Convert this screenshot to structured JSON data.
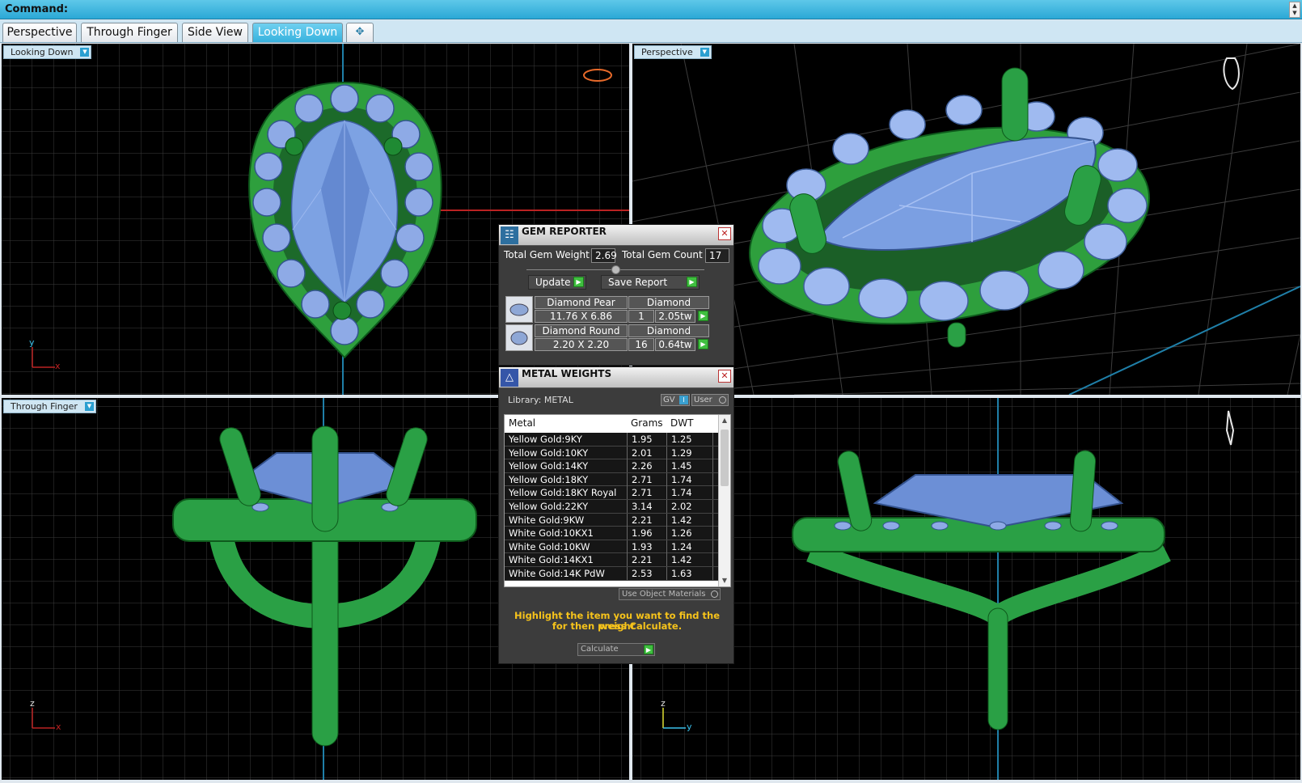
{
  "command": {
    "label": "Command:"
  },
  "tabs": [
    {
      "label": "Perspective",
      "active": false
    },
    {
      "label": "Through Finger",
      "active": false
    },
    {
      "label": "Side View",
      "active": false
    },
    {
      "label": "Looking Down",
      "active": true
    }
  ],
  "viewports": {
    "top_left": {
      "label": "Looking Down"
    },
    "top_right": {
      "label": "Perspective"
    },
    "bottom_left": {
      "label": "Through Finger"
    },
    "bottom_right": {
      "label": ""
    }
  },
  "axes": {
    "top_left": {
      "v": "y",
      "h": "x"
    },
    "bottom_left": {
      "v": "z",
      "h": "x"
    },
    "bottom_right": {
      "v": "z",
      "h": "y"
    }
  },
  "gem_reporter": {
    "title": "GEM REPORTER",
    "total_weight_label": "Total Gem Weight",
    "total_weight": "2.69",
    "total_count_label": "Total Gem Count",
    "total_count": "17",
    "update_label": "Update",
    "save_label": "Save Report",
    "gems": [
      {
        "name": "Diamond Pear",
        "material": "Diamond",
        "size": "11.76 X 6.86",
        "count": "1",
        "weight": "2.05tw"
      },
      {
        "name": "Diamond Round",
        "material": "Diamond",
        "size": "2.20 X 2.20",
        "count": "16",
        "weight": "0.64tw"
      }
    ]
  },
  "metal_weights": {
    "title": "METAL WEIGHTS",
    "library_label": "Library: METAL",
    "gv_label": "GV",
    "user_label": "User",
    "columns": [
      "Metal",
      "Grams",
      "DWT"
    ],
    "rows": [
      [
        "Yellow Gold:9KY",
        "1.95",
        "1.25"
      ],
      [
        "Yellow Gold:10KY",
        "2.01",
        "1.29"
      ],
      [
        "Yellow Gold:14KY",
        "2.26",
        "1.45"
      ],
      [
        "Yellow Gold:18KY",
        "2.71",
        "1.74"
      ],
      [
        "Yellow Gold:18KY Royal",
        "2.71",
        "1.74"
      ],
      [
        "Yellow Gold:22KY",
        "3.14",
        "2.02"
      ],
      [
        "White Gold:9KW",
        "2.21",
        "1.42"
      ],
      [
        "White Gold:10KX1",
        "1.96",
        "1.26"
      ],
      [
        "White Gold:10KW",
        "1.93",
        "1.24"
      ],
      [
        "White Gold:14KX1",
        "2.21",
        "1.42"
      ],
      [
        "White Gold:14K PdW",
        "2.53",
        "1.63"
      ]
    ],
    "use_object_materials": "Use Object Materials",
    "hint_line1": "Highlight the item you want to find the weight",
    "hint_line2": "for then press Calculate.",
    "calculate_label": "Calculate"
  },
  "colors": {
    "metal": "#2fa84a",
    "gem": "#6f93d6",
    "grid": "#3a3a3a",
    "accent": "#2ba8d6",
    "hint": "#f6c31b"
  }
}
